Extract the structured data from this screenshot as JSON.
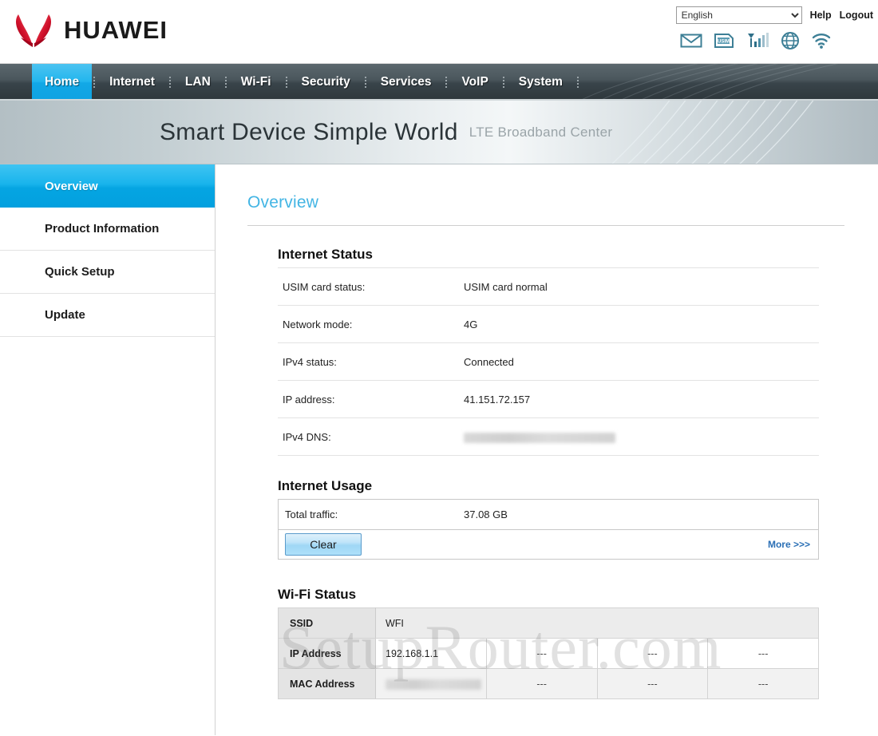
{
  "header": {
    "brand": "HUAWEI",
    "language": {
      "selected": "English",
      "options": [
        "English"
      ]
    },
    "help_label": "Help",
    "logout_label": "Logout",
    "status_icons": [
      "mail-icon",
      "usim-icon",
      "signal-icon",
      "globe-icon",
      "wifi-icon"
    ],
    "usim_icon_text": "USIM"
  },
  "nav": {
    "items": [
      {
        "label": "Home",
        "active": true
      },
      {
        "label": "Internet",
        "active": false
      },
      {
        "label": "LAN",
        "active": false
      },
      {
        "label": "Wi-Fi",
        "active": false
      },
      {
        "label": "Security",
        "active": false
      },
      {
        "label": "Services",
        "active": false
      },
      {
        "label": "VoIP",
        "active": false
      },
      {
        "label": "System",
        "active": false
      }
    ]
  },
  "banner": {
    "main": "Smart Device  Simple World",
    "sub": "LTE Broadband Center"
  },
  "sidebar": {
    "items": [
      {
        "label": "Overview",
        "active": true
      },
      {
        "label": "Product Information",
        "active": false
      },
      {
        "label": "Quick Setup",
        "active": false
      },
      {
        "label": "Update",
        "active": false
      }
    ]
  },
  "main": {
    "page_title": "Overview",
    "internet_status": {
      "heading": "Internet Status",
      "rows": [
        {
          "label": "USIM card status:",
          "value": "USIM card normal",
          "redacted": false
        },
        {
          "label": "Network mode:",
          "value": "4G",
          "redacted": false
        },
        {
          "label": "IPv4 status:",
          "value": "Connected",
          "redacted": false
        },
        {
          "label": "IP address:",
          "value": "41.151.72.157",
          "redacted": false
        },
        {
          "label": "IPv4 DNS:",
          "value": "",
          "redacted": true
        }
      ]
    },
    "internet_usage": {
      "heading": "Internet Usage",
      "total_traffic_label": "Total traffic:",
      "total_traffic_value": "37.08 GB",
      "clear_label": "Clear",
      "more_label": "More >>>"
    },
    "wifi_status": {
      "heading": "Wi-Fi Status",
      "rows": [
        {
          "label": "SSID",
          "values": [
            "WFI",
            "",
            "",
            ""
          ],
          "redacted": false
        },
        {
          "label": "IP Address",
          "values": [
            "192.168.1.1",
            "---",
            "---",
            "---"
          ],
          "redacted": false
        },
        {
          "label": "MAC Address",
          "values": [
            "",
            "---",
            "---",
            "---"
          ],
          "redacted": true
        }
      ]
    },
    "watermark": "SetupRouter.com"
  },
  "colors": {
    "accent_blue": "#00a8e8",
    "title_blue": "#43b5e4",
    "nav_dark": "#39444a",
    "link_blue": "#2a6fb5",
    "huawei_red": "#cf0a2c"
  }
}
